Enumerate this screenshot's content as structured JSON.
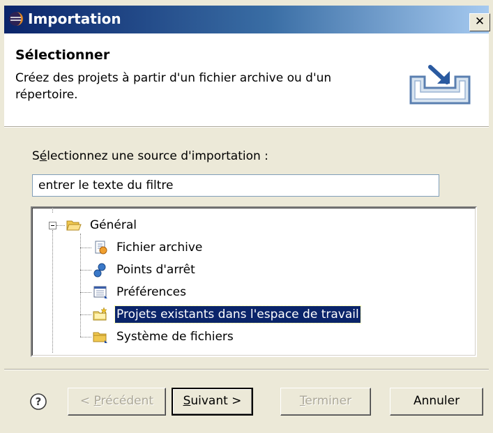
{
  "window": {
    "title": "Importation",
    "close_glyph": "✕",
    "icon": "eclipse-icon"
  },
  "header": {
    "title": "Sélectionner",
    "description": "Créez des projets à partir d'un fichier archive ou d'un répertoire.",
    "banner_icon": "import-tray-icon"
  },
  "source": {
    "label_prefix": "S",
    "label_accesskey": "é",
    "label_rest": "lectionnez une source d'importation :",
    "filter_value": "entrer le texte du filtre"
  },
  "tree": {
    "root": {
      "label": "Général",
      "icon": "open-folder-icon",
      "expanded": true
    },
    "children": [
      {
        "label": "Fichier archive",
        "icon": "archive-file-icon",
        "selected": false
      },
      {
        "label": "Points d'arrêt",
        "icon": "breakpoints-icon",
        "selected": false
      },
      {
        "label": "Préférences",
        "icon": "preferences-icon",
        "selected": false
      },
      {
        "label": "Projets existants dans l'espace de travail",
        "icon": "existing-projects-icon",
        "selected": true
      },
      {
        "label": "Système de fichiers",
        "icon": "folder-icon",
        "selected": false
      }
    ]
  },
  "buttons": {
    "back": {
      "pre": "< ",
      "accel": "P",
      "post": "récédent",
      "enabled": false
    },
    "next": {
      "pre": "",
      "accel": "S",
      "post": "uivant >",
      "enabled": true,
      "default": true
    },
    "finish": {
      "pre": "",
      "accel": "T",
      "post": "erminer",
      "enabled": false
    },
    "cancel": {
      "label": "Annuler",
      "enabled": true
    }
  },
  "colors": {
    "titlebar_start": "#0a246a",
    "titlebar_end": "#a6caf0",
    "selection": "#0a246a",
    "dialog_bg": "#ece9d8"
  }
}
